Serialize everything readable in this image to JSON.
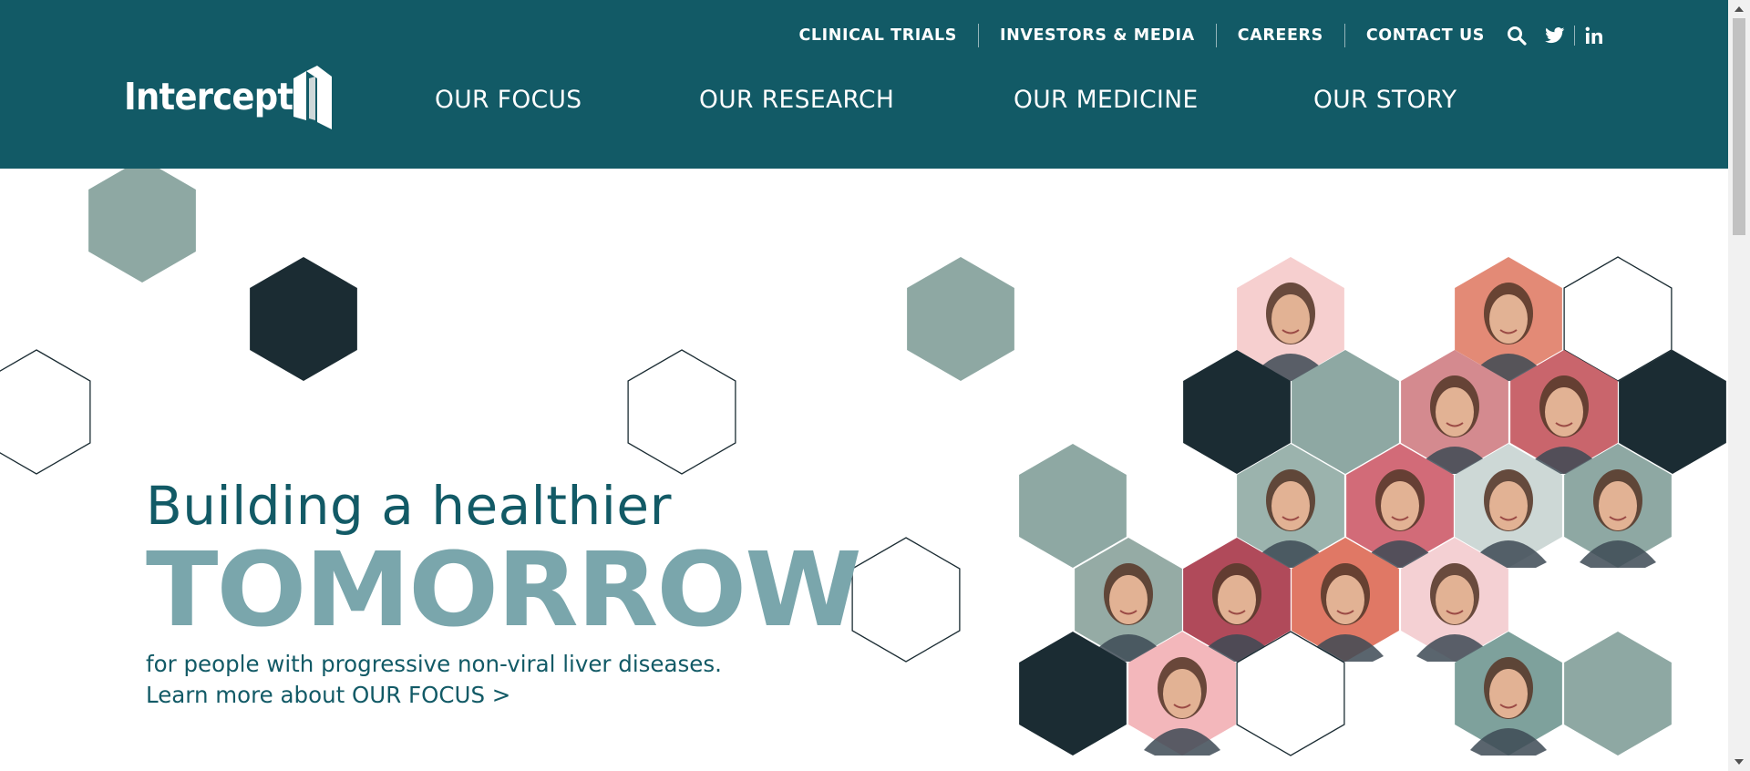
{
  "header": {
    "logo_text": "Intercept",
    "utility_links": [
      "CLINICAL TRIALS",
      "INVESTORS & MEDIA",
      "CAREERS",
      "CONTACT US"
    ],
    "utility_icons": [
      "search-icon",
      "twitter-icon",
      "linkedin-icon"
    ],
    "main_nav": [
      "OUR FOCUS",
      "OUR RESEARCH",
      "OUR MEDICINE",
      "OUR STORY"
    ]
  },
  "hero": {
    "line1": "Building a healthier",
    "line2": "TOMORROW",
    "subtitle": "for people with progressive non-viral liver diseases.",
    "cta_prefix": "Learn more about ",
    "cta_link": "OUR FOCUS >"
  },
  "colors": {
    "header_bg": "#125a66",
    "hex_sage": "#8ea8a3",
    "hex_dark": "#1b2c33",
    "hero_heading": "#125a66",
    "hero_tomorrow": "#7aa6ac"
  },
  "hexagons": [
    {
      "kind": "sage"
    },
    {
      "kind": "dark"
    },
    {
      "kind": "outline"
    },
    {
      "kind": "sage"
    },
    {
      "kind": "outline"
    },
    {
      "kind": "outline"
    },
    {
      "kind": "photo",
      "bg": "#f6cfcf"
    },
    {
      "kind": "photo",
      "bg": "#e38a76"
    },
    {
      "kind": "outline"
    },
    {
      "kind": "dark"
    },
    {
      "kind": "sage"
    },
    {
      "kind": "photo",
      "bg": "#d48a8f"
    },
    {
      "kind": "photo",
      "bg": "#c9656c"
    },
    {
      "kind": "dark"
    },
    {
      "kind": "sage"
    },
    {
      "kind": "photo",
      "bg": "#9bb3ad"
    },
    {
      "kind": "photo",
      "bg": "#d26b78"
    },
    {
      "kind": "photo",
      "bg": "#cdd8d6"
    },
    {
      "kind": "photo",
      "bg": "#8ea8a3"
    },
    {
      "kind": "photo",
      "bg": "#95aba5"
    },
    {
      "kind": "photo",
      "bg": "#b04a5a"
    },
    {
      "kind": "photo",
      "bg": "#e07865"
    },
    {
      "kind": "photo",
      "bg": "#f4d0d3"
    },
    {
      "kind": "dark"
    },
    {
      "kind": "photo",
      "bg": "#f3b7bb"
    },
    {
      "kind": "outline"
    },
    {
      "kind": "photo",
      "bg": "#7ea19c"
    },
    {
      "kind": "sage"
    }
  ]
}
